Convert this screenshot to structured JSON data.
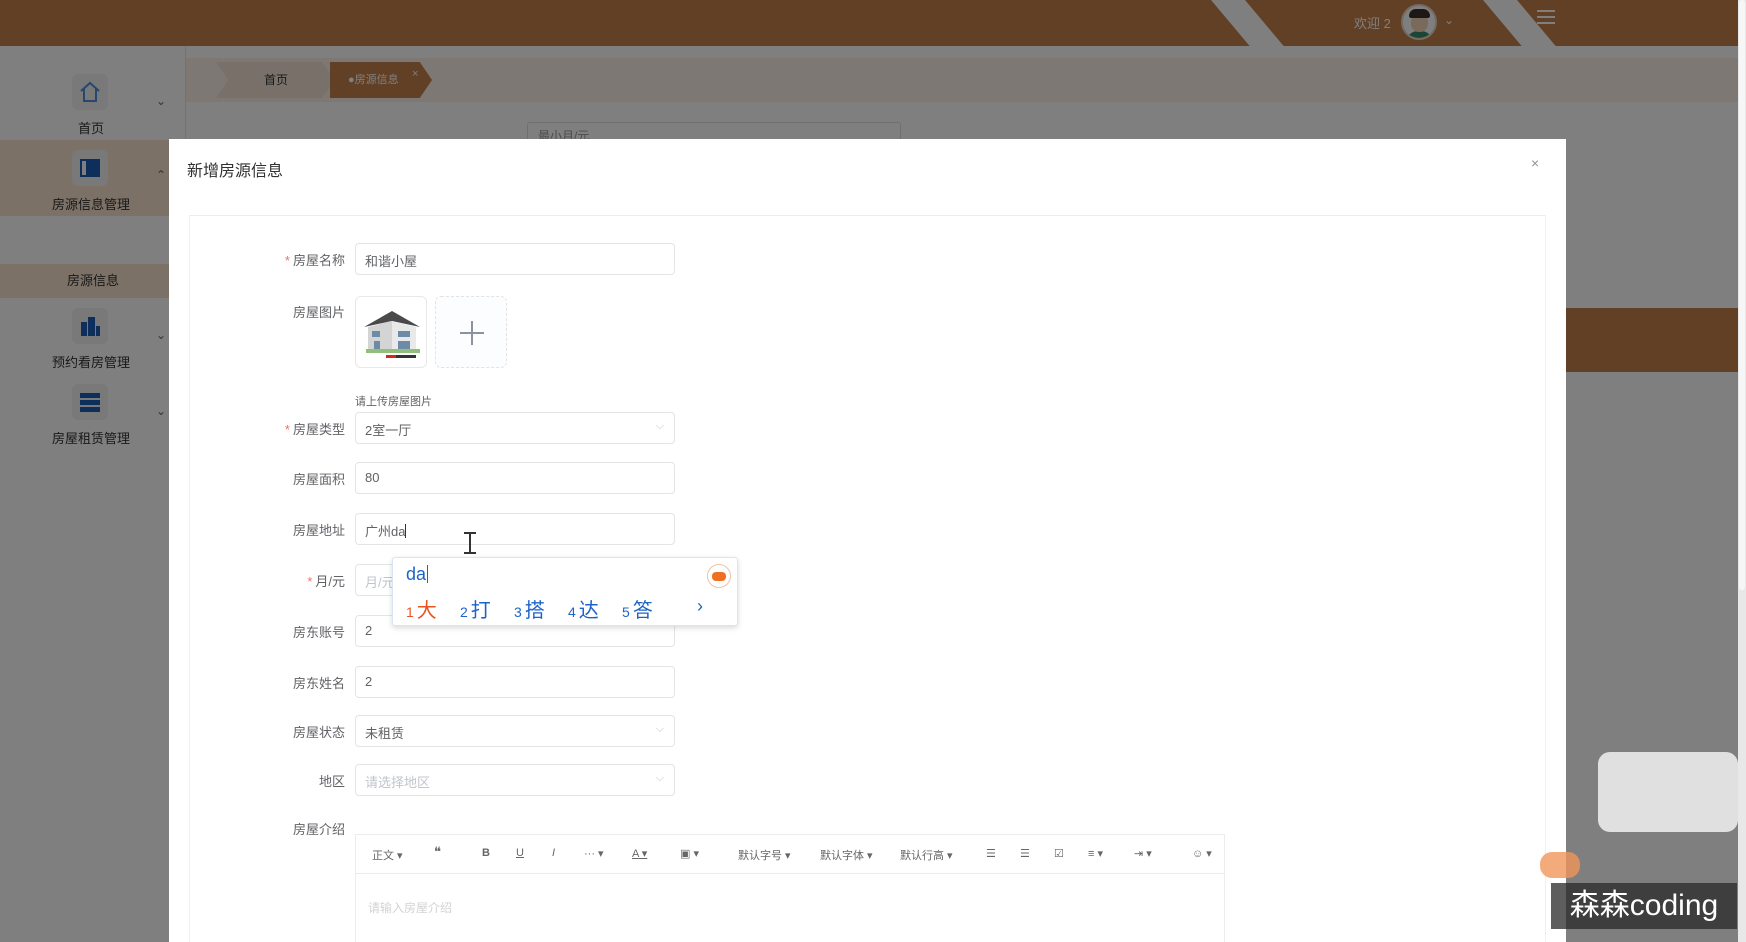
{
  "header": {
    "welcome": "欢迎 2",
    "user_menu_caret": "⌄",
    "menu_icon": "hamburger-icon"
  },
  "sidebar": {
    "items": [
      {
        "label": "首页",
        "icon": "home-icon"
      },
      {
        "label": "房源信息管理",
        "icon": "panel-icon"
      },
      {
        "label": "预约看房管理",
        "icon": "building-icon"
      },
      {
        "label": "房屋租赁管理",
        "icon": "list-icon"
      }
    ],
    "sub_item": "房源信息"
  },
  "tabs": {
    "home": "首页",
    "active": "●房源信息",
    "close": "×"
  },
  "background": {
    "search_placeholder": "最小月/元"
  },
  "dialog": {
    "title": "新增房源信息",
    "close": "×",
    "fields": {
      "name_label": "房屋名称",
      "name_value": "和谐小屋",
      "image_label": "房屋图片",
      "image_tip": "请上传房屋图片",
      "type_label": "房屋类型",
      "type_value": "2室一厅",
      "area_label": "房屋面积",
      "area_value": "80",
      "address_label": "房屋地址",
      "address_value": "广州da",
      "rent_label": "月/元",
      "rent_placeholder": "月/元",
      "landlord_account_label": "房东账号",
      "landlord_account_value": "2",
      "landlord_name_label": "房东姓名",
      "landlord_name_value": "2",
      "status_label": "房屋状态",
      "status_value": "未租赁",
      "region_label": "地区",
      "region_placeholder": "请选择地区",
      "intro_label": "房屋介绍",
      "intro_placeholder": "请输入房屋介绍"
    },
    "editor_toolbar": {
      "paragraph": "正文",
      "quote": "❝",
      "bold": "B",
      "underline": "U",
      "italic": "I",
      "more": "···",
      "font_color": "A",
      "bg_color": "A",
      "font_size": "默认字号",
      "font_family": "默认字体",
      "line_height": "默认行高",
      "bullet_list": "☰",
      "numbered_list": "☰",
      "todo": "☑",
      "align": "≡",
      "indent": "⇥",
      "emoji": "☺"
    }
  },
  "ime": {
    "composition": "da",
    "candidates": [
      {
        "num": "1",
        "text": "大"
      },
      {
        "num": "2",
        "text": "打"
      },
      {
        "num": "3",
        "text": "搭"
      },
      {
        "num": "4",
        "text": "达"
      },
      {
        "num": "5",
        "text": "答"
      }
    ],
    "next": "›"
  },
  "watermark": "森森coding",
  "colors": {
    "brand": "#c4804d",
    "ime_blue": "#1e64c8",
    "ime_first": "#e8551f",
    "required": "#f56c6c"
  }
}
